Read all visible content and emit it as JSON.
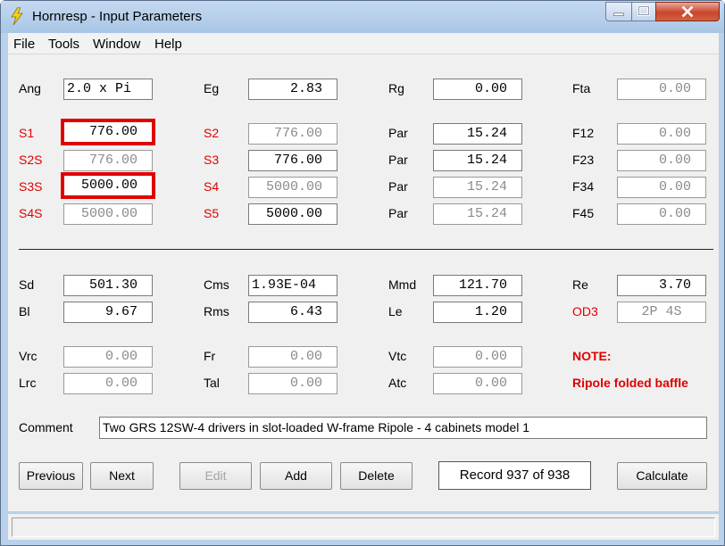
{
  "window": {
    "title": "Hornresp - Input Parameters",
    "icon": "lightning-icon"
  },
  "menu": {
    "file": "File",
    "tools": "Tools",
    "window": "Window",
    "help": "Help"
  },
  "top": {
    "ang": {
      "label": "Ang",
      "value": "2.0 x Pi"
    },
    "eg": {
      "label": "Eg",
      "value": "2.83"
    },
    "rg": {
      "label": "Rg",
      "value": "0.00"
    },
    "fta": {
      "label": "Fta",
      "value": "0.00"
    }
  },
  "horn": {
    "s1": {
      "label": "S1",
      "value": "776.00"
    },
    "s2s": {
      "label": "S2S",
      "value": "776.00"
    },
    "s3s": {
      "label": "S3S",
      "value": "5000.00"
    },
    "s4s": {
      "label": "S4S",
      "value": "5000.00"
    },
    "s2": {
      "label": "S2",
      "value": "776.00"
    },
    "s3": {
      "label": "S3",
      "value": "776.00"
    },
    "s4": {
      "label": "S4",
      "value": "5000.00"
    },
    "s5": {
      "label": "S5",
      "value": "5000.00"
    },
    "par1": {
      "label": "Par",
      "value": "15.24"
    },
    "par2": {
      "label": "Par",
      "value": "15.24"
    },
    "par3": {
      "label": "Par",
      "value": "15.24"
    },
    "par4": {
      "label": "Par",
      "value": "15.24"
    },
    "f12": {
      "label": "F12",
      "value": "0.00"
    },
    "f23": {
      "label": "F23",
      "value": "0.00"
    },
    "f34": {
      "label": "F34",
      "value": "0.00"
    },
    "f45": {
      "label": "F45",
      "value": "0.00"
    }
  },
  "driver": {
    "sd": {
      "label": "Sd",
      "value": "501.30"
    },
    "bl": {
      "label": "Bl",
      "value": "9.67"
    },
    "cms": {
      "label": "Cms",
      "value": "1.93E-04"
    },
    "rms": {
      "label": "Rms",
      "value": "6.43"
    },
    "mmd": {
      "label": "Mmd",
      "value": "121.70"
    },
    "le": {
      "label": "Le",
      "value": "1.20"
    },
    "re": {
      "label": "Re",
      "value": "3.70"
    },
    "od3": {
      "label": "OD3",
      "value": "2P 4S"
    }
  },
  "chambers": {
    "vrc": {
      "label": "Vrc",
      "value": "0.00"
    },
    "lrc": {
      "label": "Lrc",
      "value": "0.00"
    },
    "fr": {
      "label": "Fr",
      "value": "0.00"
    },
    "tal": {
      "label": "Tal",
      "value": "0.00"
    },
    "vtc": {
      "label": "Vtc",
      "value": "0.00"
    },
    "atc": {
      "label": "Atc",
      "value": "0.00"
    },
    "note_label": "NOTE:",
    "note_text": "Ripole folded baffle"
  },
  "comment": {
    "label": "Comment",
    "value": "Two GRS 12SW-4 drivers in slot-loaded W-frame Ripole - 4 cabinets model 1"
  },
  "buttons": {
    "previous": "Previous",
    "next": "Next",
    "edit": "Edit",
    "add": "Add",
    "delete": "Delete",
    "calculate": "Calculate"
  },
  "record": "Record 937 of 938",
  "colors": {
    "red_label": "#e00000",
    "highlight": "#e00000",
    "disabled_text": "#8a8a8a"
  }
}
